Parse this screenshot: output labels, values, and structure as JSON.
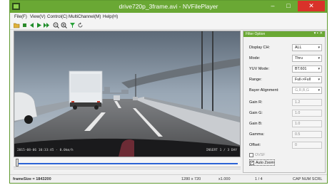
{
  "window": {
    "title": "drive720p_3frame.avi - NVFilePlayer"
  },
  "menu": [
    "File(F)",
    "View(V)",
    "Control(C)",
    "MultiChannel(M)",
    "Help(H)"
  ],
  "toolbar_icons": [
    "open-icon",
    "stop-icon",
    "step-back-icon",
    "play-icon",
    "step-forward-icon",
    "zoom-out-icon",
    "zoom-in-icon",
    "filter-icon",
    "refresh-icon"
  ],
  "video": {
    "osd_left": "2015-08-06 10:33:45 - 0.0km/h",
    "osd_right": "INSERT 1 / 3 DAY"
  },
  "panel": {
    "title": "Filter Option",
    "display_ch": {
      "label": "Display CH:",
      "value": "ALL"
    },
    "mode": {
      "label": "Mode:",
      "value": "Thru"
    },
    "yuv_mode": {
      "label": "YUV Mode:",
      "value": "BT.601"
    },
    "range": {
      "label": "Range:",
      "value": "Full->Full"
    },
    "bayer": {
      "label": "Bayer Alignment:",
      "value": "G,R,B,G"
    },
    "gain_r": {
      "label": "Gain R:",
      "value": "1.2"
    },
    "gain_g": {
      "label": "Gain G:",
      "value": "1.0"
    },
    "gain_b": {
      "label": "Gain B:",
      "value": "1.0"
    },
    "gamma": {
      "label": "Gamma:",
      "value": "0.5"
    },
    "offset": {
      "label": "Offset:",
      "value": "0"
    },
    "ovsf": {
      "label": "OVSF",
      "checked": false
    },
    "auto_zoom": {
      "label": "Auto Zoom",
      "checked": true
    }
  },
  "status": {
    "frame_size": "frameSize = 1843200",
    "resolution": "1280 x 720",
    "zoom": "x1.000",
    "frame": "1 / 4",
    "indicators": "CAP NUM SCRL"
  },
  "colors": {
    "accent": "#6aa834",
    "close": "#d9322a",
    "seek": "#2c64d6"
  }
}
